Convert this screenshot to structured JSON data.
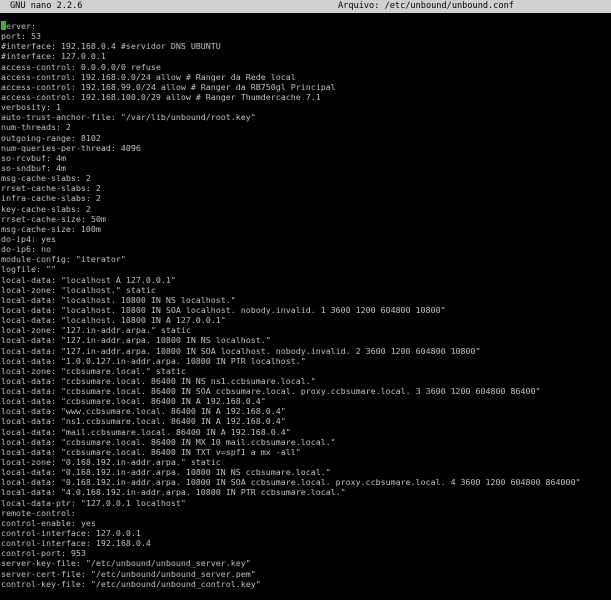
{
  "title_bar": {
    "app": "GNU nano 2.2.6",
    "file": "Arquivo: /etc/unbound/unbound.conf"
  },
  "editor": {
    "lines": [
      "server:",
      "port: 53",
      "#interface: 192.168.0.4 #servidor DNS UBUNTU",
      "#interface: 127.0.0.1",
      "access-control: 0.0.0.0/0 refuse",
      "access-control: 192.168.0.0/24 allow # Ranger da Rede local",
      "access-control: 192.168.99.0/24 allow # Ranger da RB750gl Principal",
      "access-control: 192.168.100.0/29 allow # Ranger Thumdercache 7.1",
      "verbosity: 1",
      "auto-trust-anchor-file: \"/var/lib/unbound/root.key\"",
      "num-threads: 2",
      "outgoing-range: 8102",
      "num-queries-per-thread: 4096",
      "so-rcvbuf: 4m",
      "so-sndbuf: 4m",
      "msg-cache-slabs: 2",
      "rrset-cache-slabs: 2",
      "infra-cache-slabs: 2",
      "key-cache-slabs: 2",
      "rrset-cache-size: 50m",
      "msg-cache-size: 100m",
      "do-ip4: yes",
      "do-ip6: no",
      "module-config: \"iterator\"",
      "logfile: \"\"",
      "local-data: \"localhost A 127.0.0.1\"",
      "local-zone: \"localhost.\" static",
      "local-data: \"localhost. 10800 IN NS localhost.\"",
      "local-data: \"localhost. 10800 IN SOA localhost. nobody.invalid. 1 3600 1200 604800 10800\"",
      "local-data: \"localhost. 10800 IN A 127.0.0.1\"",
      "local-zone: \"127.in-addr.arpa.\" static",
      "local-data: \"127.in-addr.arpa. 10800 IN NS localhost.\"",
      "local-data: \"127.in-addr.arpa. 10800 IN SOA localhost. nobody.invalid. 2 3600 1200 604800 10800\"",
      "local-data: \"1.0.0.127.in-addr.arpa. 10800 IN PTR localhost.\"",
      "local-zone: \"ccbsumare.local.\" static",
      "local-data: \"ccbsumare.local. 86400 IN NS ns1.ccbsumare.local.\"",
      "local-data: \"ccbsumare.local. 86400 IN SOA ccbsumare.local. proxy.ccbsumare.local. 3 3600 1200 604800 86400\"",
      "local-data: \"ccbsumare.local. 86400 IN A 192.168.0.4\"",
      "local-data: \"www.ccbsumare.local. 86400 IN A 192.168.0.4\"",
      "local-data: \"ns1.ccbsumare.local. 86400 IN A 192.168.0.4\"",
      "local-data: \"mail.ccbsumare.local. 86400 IN A 192.168.0.4\"",
      "local-data: \"ccbsumare.local. 86400 IN MX 10 mail.ccbsumare.local.\"",
      "local-data: \"ccbsumare.local. 86400 IN TXT v=spf1 a mx -all\"",
      "local-zone: \"0.168.192.in-addr.arpa.\" static",
      "local-data: \"0.168.192.in-addr.arpa. 10800 IN NS ccbsumare.local.\"",
      "local-data: \"0.168.192.in-addr.arpa. 10800 IN SOA ccbsumare.local. proxy.ccbsumare.local. 4 3600 1200 604800 864000\"",
      "local-data: \"4.0.168.192.in-addr.arpa. 10800 IN PTR ccbsumare.local.\"",
      "local-data-ptr: \"127.0.0.1 localhost\"",
      "remote-control:",
      "control-enable: yes",
      "control-interface: 127.0.0.1",
      "control-interface: 192.168.0.4",
      "control-port: 953",
      "server-key-file: \"/etc/unbound/unbound_server.key\"",
      "server-cert-file: \"/etc/unbound/unbound_server.pem\"",
      "control-key-file: \"/etc/unbound/unbound_control.key\""
    ]
  }
}
